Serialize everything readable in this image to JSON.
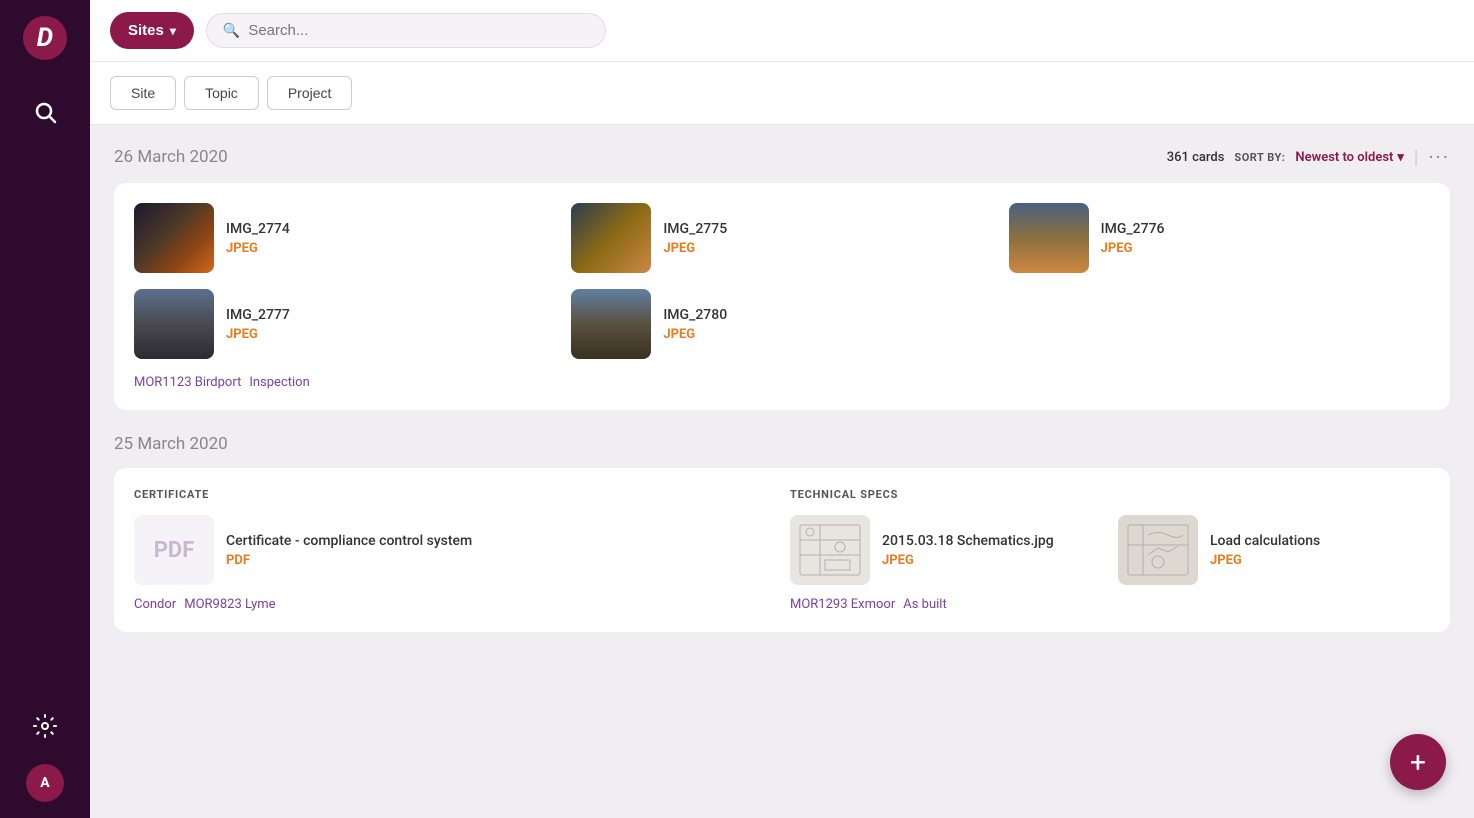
{
  "sidebar": {
    "logo": "D",
    "avatar_label": "A",
    "items": [
      {
        "name": "search",
        "icon": "search"
      },
      {
        "name": "settings",
        "icon": "settings"
      }
    ]
  },
  "topbar": {
    "sites_label": "Sites",
    "search_placeholder": "Search...",
    "tabs": [
      {
        "id": "site",
        "label": "Site",
        "active": false
      },
      {
        "id": "topic",
        "label": "Topic",
        "active": false
      },
      {
        "id": "project",
        "label": "Project",
        "active": false
      }
    ]
  },
  "section1": {
    "date": "26 March 2020",
    "card_count": "361 cards",
    "sort_label": "SORT BY:",
    "sort_value": "Newest to oldest",
    "more_label": "···",
    "files": [
      {
        "name": "IMG_2774",
        "type": "JPEG",
        "thumb": "1"
      },
      {
        "name": "IMG_2775",
        "type": "JPEG",
        "thumb": "2"
      },
      {
        "name": "IMG_2776",
        "type": "JPEG",
        "thumb": "3"
      },
      {
        "name": "IMG_2777",
        "type": "JPEG",
        "thumb": "4"
      },
      {
        "name": "IMG_2780",
        "type": "JPEG",
        "thumb": "5"
      }
    ],
    "tags": [
      "MOR1123 Birdport",
      "Inspection"
    ]
  },
  "section2": {
    "date": "25 March 2020",
    "certificate": {
      "section_label": "CERTIFICATE",
      "files": [
        {
          "name": "Certificate - compliance control system",
          "type": "PDF",
          "thumb": "pdf"
        }
      ],
      "tags": [
        "Condor",
        "MOR9823 Lyme"
      ]
    },
    "technical_specs": {
      "section_label": "TECHNICAL SPECS",
      "files": [
        {
          "name": "2015.03.18 Schematics.jpg",
          "type": "JPEG",
          "thumb": "schematic"
        },
        {
          "name": "Load calculations",
          "type": "JPEG",
          "thumb": "load"
        }
      ],
      "tags": [
        "MOR1293 Exmoor",
        "As built"
      ]
    }
  },
  "fab_label": "+"
}
